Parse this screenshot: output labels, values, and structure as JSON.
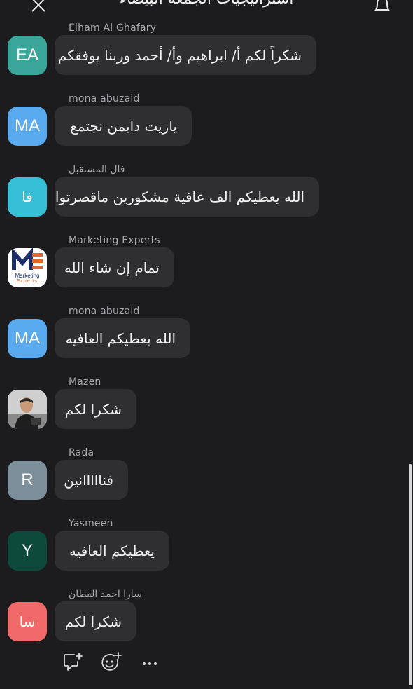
{
  "header": {
    "title": "استراتيجيات الجمعة البيضاء"
  },
  "colors": {
    "background": "#1c1c1e",
    "bubble": "#2f2f31",
    "sender_text": "#a8a8ad"
  },
  "messages": [
    {
      "sender": "Elham Al Ghafary",
      "avatar_text": "EA",
      "avatar_color": "#3aa69a",
      "text": "شكراً لكم أ/ ابراهيم وأ/ أحمد وربنا يوفقكم"
    },
    {
      "sender": "mona abuzaid",
      "avatar_text": "MA",
      "avatar_color": "#5aaaf0",
      "text": "ياريت دايمن نجتمع"
    },
    {
      "sender": "فال المستقبل",
      "avatar_text": "فا",
      "avatar_color": "#36bfd6",
      "text": "الله يعطيكم الف عافية مشكورين ماقصرتوا"
    },
    {
      "sender": "Marketing Experts",
      "avatar_text": "",
      "avatar_logo_text": "Marketing",
      "avatar_logo_sub": "Experts",
      "avatar_color": "#ffffff",
      "text": "تمام إن شاء الله"
    },
    {
      "sender": "mona abuzaid",
      "avatar_text": "MA",
      "avatar_color": "#5aaaf0",
      "text": "الله يعطيكم العافيه"
    },
    {
      "sender": "Mazen",
      "avatar_text": "",
      "avatar_color": "#cfcfcf",
      "text": "شكرا لكم"
    },
    {
      "sender": "Rada",
      "avatar_text": "R",
      "avatar_color": "#7d8f9a",
      "text": "فنااااانين"
    },
    {
      "sender": "Yasmeen",
      "avatar_text": "Y",
      "avatar_color": "#0d4a3c",
      "text": "يعطيكم العافيه"
    },
    {
      "sender": "سارا احمد القطان",
      "avatar_text": "سا",
      "avatar_color": "#f06a6a",
      "text": "شكرا لكم"
    }
  ],
  "toolbar": {
    "icons": [
      "reply-icon",
      "add-reaction-icon",
      "more-icon"
    ]
  }
}
